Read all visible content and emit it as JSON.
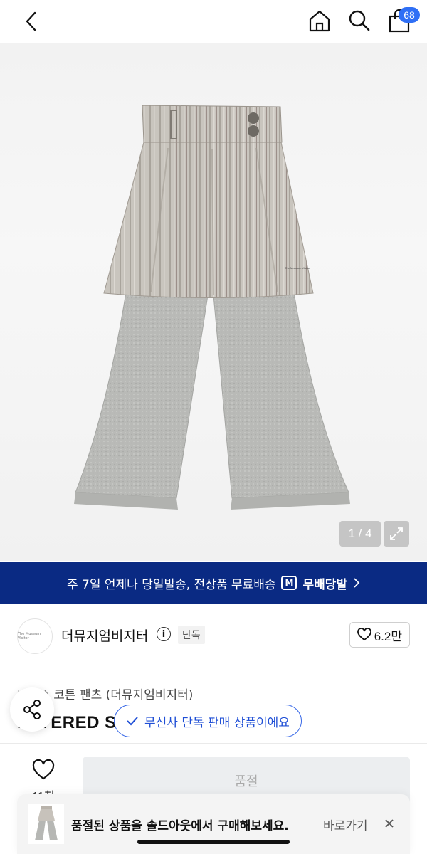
{
  "header": {
    "cart_count": "68"
  },
  "gallery": {
    "page_indicator": "1 / 4",
    "brand_print": "The Museum Visitor"
  },
  "banner": {
    "text": "주 7일 언제나 당일발송, 전상품 무료배송",
    "logo_text": "M",
    "service_name": "무배당발"
  },
  "brand": {
    "name": "더뮤지엄비지터",
    "info_glyph": "i",
    "exclusive_label": "단독",
    "logo_text": "The Museum Visitor",
    "likes": "6.2만"
  },
  "product": {
    "breadcrumb_root": "바지",
    "breadcrumb": "코튼 팬츠 (더뮤지엄비지터)",
    "title": "LAYERED S"
  },
  "toast": {
    "text": "무신사 단독 판매 상품이에요"
  },
  "action_bar": {
    "wish_count": "11천",
    "soldout_label": "품절"
  },
  "suggestion": {
    "text": "품절된 상품을 솔드아웃에서 구매해보세요.",
    "link_label": "바로가기"
  },
  "colors": {
    "accent": "#2f6ff5",
    "banner_bg": "#0a2a83",
    "toast_border": "#3d6ce8"
  }
}
